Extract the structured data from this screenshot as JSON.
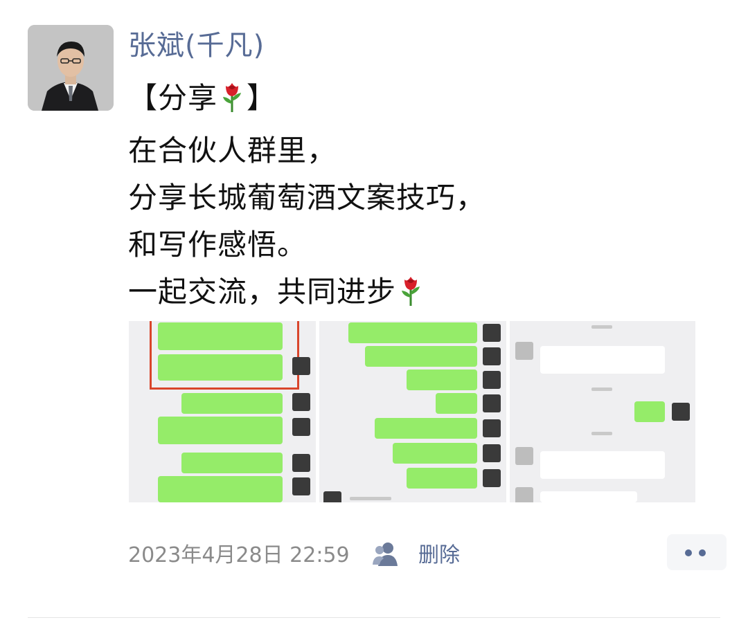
{
  "post": {
    "author": "张斌(千凡)",
    "lines": [
      "【分享",
      "】",
      "在合伙人群里，",
      "分享长城葡萄酒文案技巧，",
      "和写作感悟。",
      "一起交流，共同进步"
    ],
    "emoji": "rose-emoji"
  },
  "meta": {
    "timestamp": "2023年4月28日 22:59",
    "delete_label": "删除",
    "privacy_icon": "friends-visibility-icon",
    "more_icon": "more-dots-icon"
  },
  "colors": {
    "link": "#576b95",
    "meta_text": "#8a8a8a",
    "chat_bubble": "#95ec69"
  }
}
